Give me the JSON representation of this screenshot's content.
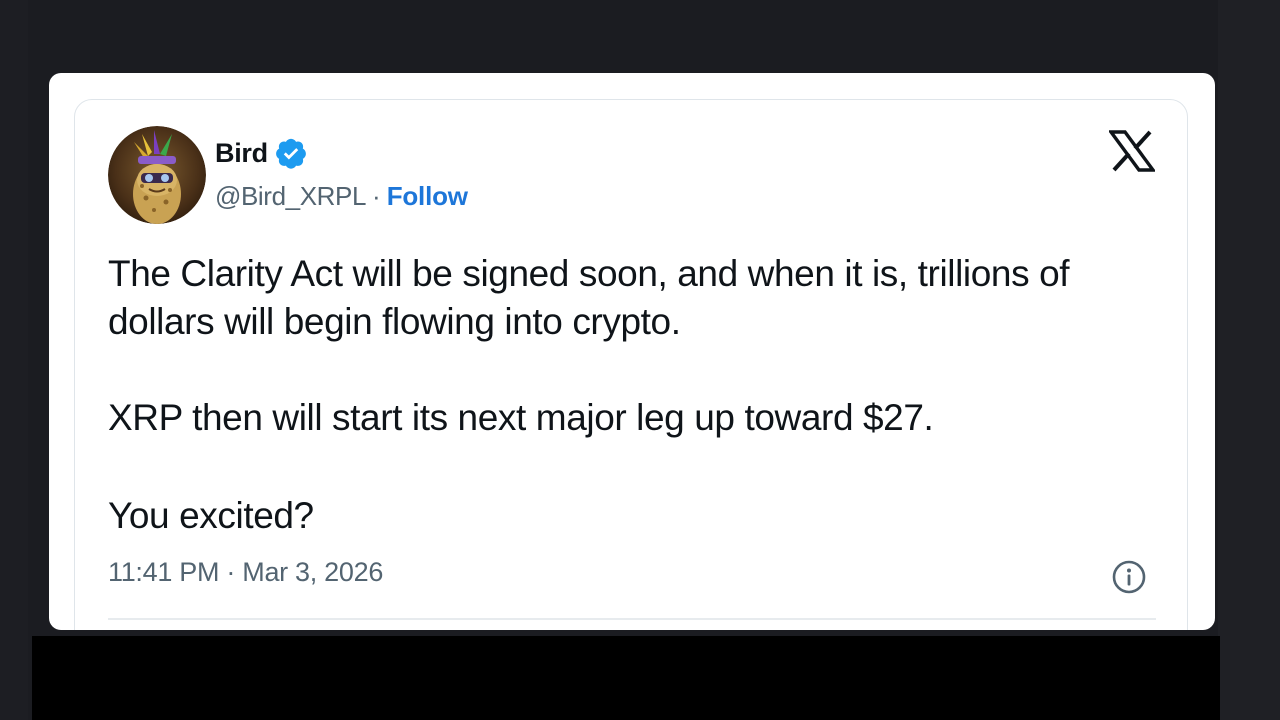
{
  "tweet": {
    "display_name": "Bird",
    "handle": "@Bird_XRPL",
    "separator": "·",
    "follow_label": "Follow",
    "text_line1": "The Clarity Act will be signed soon, and when it is, trillions of dollars will begin flowing into crypto.",
    "text_line2": "XRP then will start its next major leg up toward $27.",
    "text_line3": "You excited?",
    "timestamp": "11:41 PM · Mar 3, 2026",
    "verified": true
  },
  "icons": {
    "platform_logo": "x-logo-icon",
    "verified_badge": "verified-badge-icon",
    "info": "info-icon"
  },
  "colors": {
    "background": "#1b1c21",
    "card": "#ffffff",
    "text": "#0f1419",
    "secondary_text": "#536471",
    "follow_link": "#1d76d9",
    "verified_badge": "#1d9bf0"
  }
}
